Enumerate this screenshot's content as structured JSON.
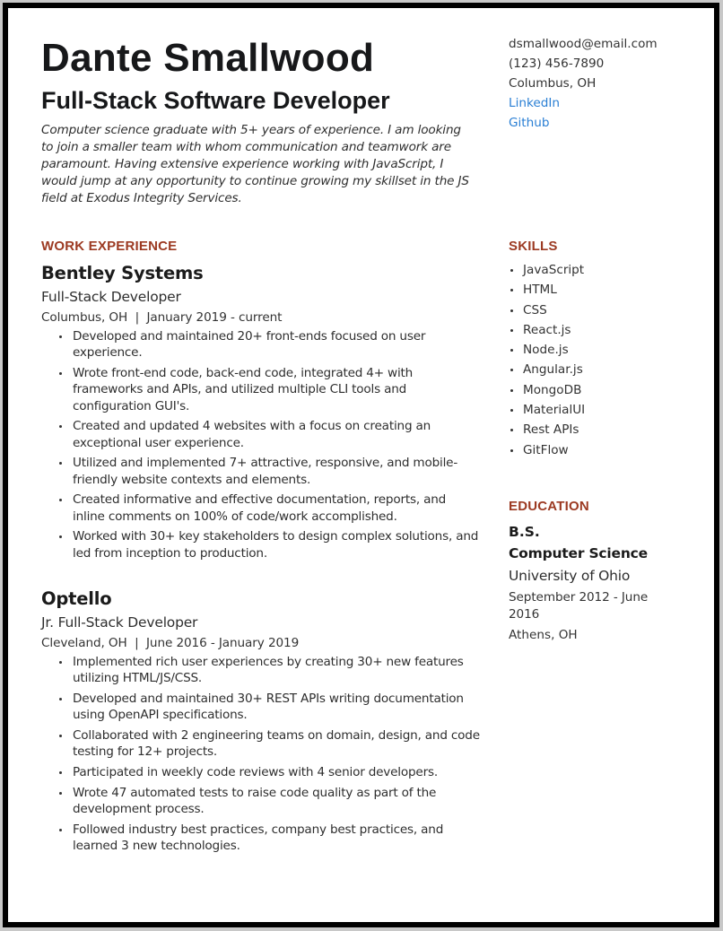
{
  "header": {
    "name": "Dante Smallwood",
    "title": "Full-Stack Software Developer",
    "summary": "Computer science graduate with 5+ years of experience. I am looking to join a smaller team with whom communication and teamwork are paramount. Having extensive experience working with JavaScript, I would jump at any opportunity to continue growing my skillset in the JS field at Exodus Integrity Services."
  },
  "contact": {
    "email": "dsmallwood@email.com",
    "phone": "(123) 456-7890",
    "location": "Columbus, OH",
    "linkedin": "LinkedIn",
    "github": "Github"
  },
  "colors": {
    "heading_accent": "#9c3a22",
    "link": "#2a7fd4",
    "text": "#2e2e2e"
  },
  "work": {
    "heading": "WORK EXPERIENCE",
    "jobs": [
      {
        "company": "Bentley Systems",
        "role": "Full-Stack Developer",
        "meta": "Columbus, OH  |  January 2019 - current",
        "bullets": [
          "Developed and maintained 20+ front-ends focused on user experience.",
          "Wrote front-end code, back-end code, integrated 4+ with frameworks and APIs, and utilized multiple CLI tools and configuration GUI's.",
          "Created and updated 4 websites with a focus on creating an exceptional user experience.",
          "Utilized and implemented 7+ attractive, responsive, and mobile-friendly website contexts and elements.",
          "Created informative and effective documentation, reports, and inline comments on 100% of code/work accomplished.",
          "Worked with 30+ key stakeholders to design complex solutions, and led from inception to production."
        ]
      },
      {
        "company": "Optello",
        "role": "Jr. Full-Stack Developer",
        "meta": "Cleveland, OH  |  June 2016 - January 2019",
        "bullets": [
          "Implemented rich user experiences by creating 30+ new features utilizing HTML/JS/CSS.",
          "Developed and maintained 30+ REST APIs writing documentation using OpenAPI specifications.",
          "Collaborated with 2 engineering teams on domain, design, and code testing for 12+ projects.",
          "Participated in weekly code reviews with 4 senior developers.",
          "Wrote 47 automated tests to raise code quality as part of the development process.",
          "Followed industry best practices, company best practices, and learned 3 new technologies."
        ]
      }
    ]
  },
  "skills": {
    "heading": "SKILLS",
    "items": [
      "JavaScript",
      "HTML",
      "CSS",
      "React.js",
      "Node.js",
      "Angular.js",
      "MongoDB",
      "MaterialUI",
      "Rest APIs",
      "GitFlow"
    ]
  },
  "education": {
    "heading": "EDUCATION",
    "degree": "B.S.",
    "field": "Computer Science",
    "school": "University of Ohio",
    "dates": "September 2012 - June 2016",
    "location": "Athens, OH"
  }
}
